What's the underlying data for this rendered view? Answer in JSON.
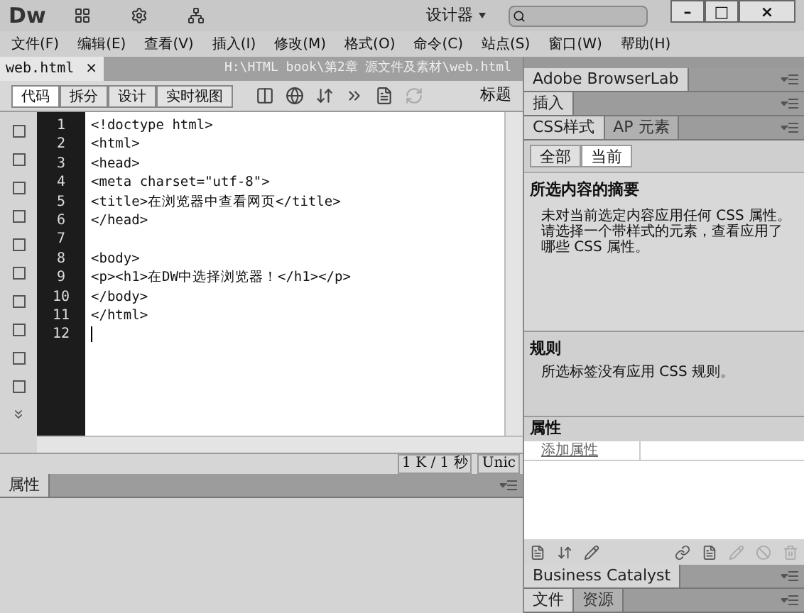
{
  "app": {
    "logo": "Dw",
    "workspace": "设计器",
    "window_buttons": [
      "–",
      "□",
      "×"
    ]
  },
  "menu": [
    "文件(F)",
    "编辑(E)",
    "查看(V)",
    "插入(I)",
    "修改(M)",
    "格式(O)",
    "命令(C)",
    "站点(S)",
    "窗口(W)",
    "帮助(H)"
  ],
  "document_tab": {
    "name": "web.html",
    "close": "×",
    "path": "H:\\HTML book\\第2章 源文件及素材\\web.html"
  },
  "view_buttons": [
    {
      "label": "代码",
      "selected": true
    },
    {
      "label": "拆分",
      "selected": false
    },
    {
      "label": "设计",
      "selected": false
    },
    {
      "label": "实时视图",
      "selected": false
    }
  ],
  "toolbar_title": "标题",
  "code_lines": [
    {
      "number": "1",
      "text": "<!doctype html>"
    },
    {
      "number": "2",
      "text": "<html>"
    },
    {
      "number": "3",
      "text": "<head>"
    },
    {
      "number": "4",
      "text": "<meta charset=\"utf-8\">"
    },
    {
      "number": "5",
      "text": "<title>在浏览器中查看网页</title>"
    },
    {
      "number": "6",
      "text": "</head>"
    },
    {
      "number": "7"
    },
    {
      "number": "8",
      "text": "<body>"
    },
    {
      "number": "9",
      "text": "<p><h1>在DW中选择浏览器！</h1></p>"
    },
    {
      "number": "10",
      "text": "</body>"
    },
    {
      "number": "11",
      "text": "</html>"
    },
    {
      "number": "12"
    }
  ],
  "status": {
    "size": "1 K / 1 秒",
    "encoding": "Unic"
  },
  "properties_panel": {
    "title": "属性"
  },
  "right_panel": {
    "panels": [
      {
        "title": "Adobe BrowserLab"
      },
      {
        "title": "插入"
      }
    ],
    "css_tabs": [
      {
        "label": "CSS样式",
        "selected": true
      },
      {
        "label": "AP 元素",
        "selected": false
      }
    ],
    "mode_buttons": [
      {
        "label": "全部",
        "selected": false
      },
      {
        "label": "当前",
        "selected": true
      }
    ],
    "summary_title": "所选内容的摘要",
    "summary_text": "未对当前选定内容应用任何 CSS 属性。请选择一个带样式的元素，查看应用了哪些 CSS 属性。",
    "rules_title": "规则",
    "rules_text": "所选标签没有应用 CSS 规则。",
    "props_title": "属性",
    "add_property": "添加属性",
    "bottom_panels": [
      {
        "tabs": [
          {
            "label": "Business Catalyst",
            "selected": true
          }
        ]
      },
      {
        "tabs": [
          {
            "label": "文件",
            "selected": true
          },
          {
            "label": "资源",
            "selected": false
          }
        ]
      }
    ]
  }
}
